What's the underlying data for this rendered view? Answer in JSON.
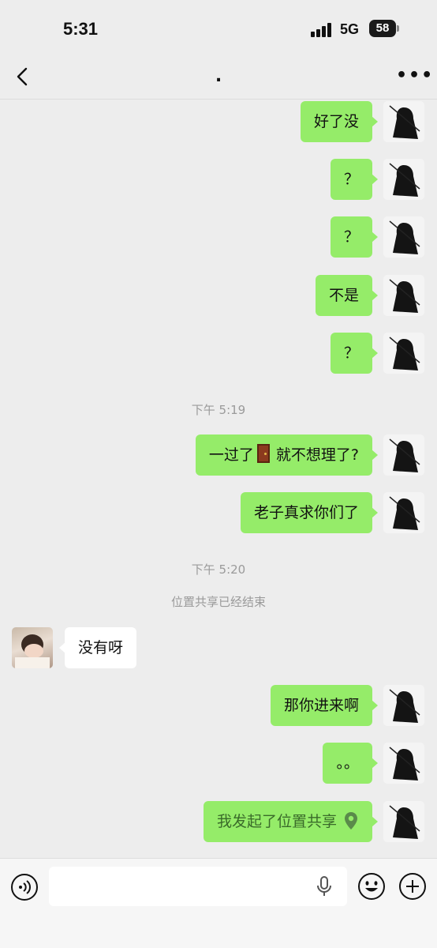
{
  "status_bar": {
    "time": "5:31",
    "network": "5G",
    "battery": "58"
  },
  "nav": {
    "title": "."
  },
  "messages": [
    {
      "side": "self",
      "text": "好了没"
    },
    {
      "side": "self",
      "text": "？"
    },
    {
      "side": "self",
      "text": "？"
    },
    {
      "side": "self",
      "text": "不是"
    },
    {
      "side": "self",
      "text": "？"
    },
    {
      "timestamp": "下午 5:19"
    },
    {
      "side": "self",
      "text_before": "一过了",
      "emoji": "door",
      "text_after": "就不想理了?"
    },
    {
      "side": "self",
      "text": "老子真求你们了"
    },
    {
      "timestamp": "下午 5:20"
    },
    {
      "system": "位置共享已经结束"
    },
    {
      "side": "other",
      "text": "没有呀"
    },
    {
      "side": "self",
      "text": "那你进来啊"
    },
    {
      "side": "self",
      "text": "。。"
    },
    {
      "side": "self",
      "text": "我发起了位置共享",
      "icon": "location-pin-icon",
      "text_color": "#3a6b2a"
    }
  ],
  "input_bar": {
    "placeholder": ""
  },
  "colors": {
    "self_bubble": "#95ec69",
    "other_bubble": "#ffffff",
    "background": "#ededed"
  }
}
